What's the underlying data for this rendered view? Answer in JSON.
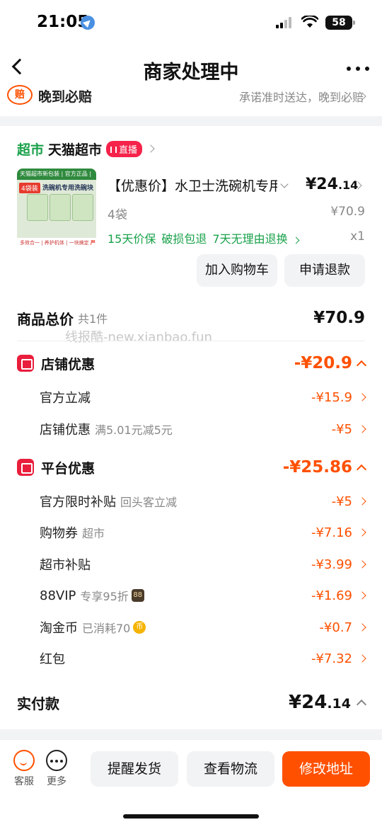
{
  "status": {
    "time": "21:05",
    "battery": "58"
  },
  "nav": {
    "title": "商家处理中"
  },
  "promise": {
    "badge": "赔",
    "title": "晚到必赔",
    "desc": "承诺准时送达，晚到必赔"
  },
  "store": {
    "tag": "超市",
    "name": "天猫超市",
    "live": "直播"
  },
  "product": {
    "title": "【优惠价】水卫士洗碗机专用洗碗块",
    "price_main": "¥24",
    "price_decimal": ".14",
    "quantity": "4袋",
    "original_price": "¥70.9",
    "services": [
      "15天价保",
      "破损包退",
      "7天无理由退换"
    ],
    "count": "x1",
    "image_text": {
      "band": "天猫超市新包装 | 官方正品 | 极速送达",
      "tag": "4袋装",
      "label": "洗碗机专用洗碗块",
      "footer": "多效合一 | 养护机体 | 一块搞定",
      "corner": "严选"
    }
  },
  "buttons": {
    "add_cart": "加入购物车",
    "refund": "申请退款"
  },
  "summary": {
    "title": "商品总价",
    "count": "共1件",
    "total": "¥70.9"
  },
  "watermark": "线报酷-new.xianbao.fun",
  "store_discount": {
    "title": "店铺优惠",
    "total": "-¥20.9",
    "items": [
      {
        "label": "官方立减",
        "note": "",
        "value": "-¥15.9"
      },
      {
        "label": "店铺优惠",
        "note": "满5.01元减5元",
        "value": "-¥5"
      }
    ]
  },
  "platform_discount": {
    "title": "平台优惠",
    "total": "-¥25.86",
    "items": [
      {
        "label": "官方限时补贴",
        "note": "回头客立减",
        "value": "-¥5"
      },
      {
        "label": "购物券",
        "note": "超市",
        "value": "-¥7.16"
      },
      {
        "label": "超市补贴",
        "note": "",
        "value": "-¥3.99"
      },
      {
        "label": "88VIP",
        "note": "专享95折",
        "badge": "88",
        "value": "-¥1.69"
      },
      {
        "label": "淘金币",
        "note": "已消耗70",
        "badge": "币",
        "value": "-¥0.7"
      },
      {
        "label": "红包",
        "note": "",
        "value": "-¥7.32"
      }
    ]
  },
  "paid": {
    "title": "实付款",
    "value_main": "¥24",
    "value_decimal": ".14"
  },
  "bottom": {
    "service_label": "客服",
    "more_label": "更多",
    "remind": "提醒发货",
    "logistics": "查看物流",
    "modify_address": "修改地址"
  },
  "colors": {
    "accent": "#ff5000",
    "green": "#19a14a",
    "red_badge": "#e91e3c"
  }
}
